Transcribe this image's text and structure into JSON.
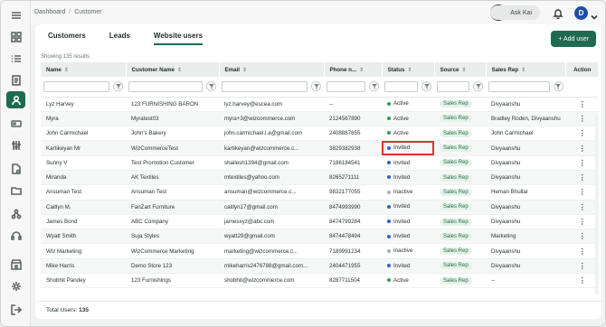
{
  "breadcrumb": {
    "root": "Dashboard",
    "separator": "/",
    "current": "Customer"
  },
  "user": {
    "ask_label": "Ask Kai",
    "initial": "D"
  },
  "tabs": [
    {
      "label": "Customers",
      "active": false
    },
    {
      "label": "Leads",
      "active": false
    },
    {
      "label": "Website users",
      "active": true
    }
  ],
  "add_user_label": "+ Add user",
  "showing_text": "Showing 135 results",
  "columns": [
    "Name",
    "Customer Name",
    "Email",
    "Phone n...",
    "Status",
    "Source",
    "Sales Rep",
    "Action"
  ],
  "rows": [
    {
      "name": "Lyz Harvey",
      "customer": "123 FURNISHING BARON",
      "email": "lyz.harvey@escea.com",
      "phone": "--",
      "status": "Active",
      "source": "Sales Rep",
      "rep": "Divyaanshu"
    },
    {
      "name": "Myra",
      "customer": "Myratest03",
      "email": "myra+3@wizcommerce.com",
      "phone": "2124567890",
      "status": "Active",
      "source": "Sales Rep",
      "rep": "Bradley Roden, Divyaanshu"
    },
    {
      "name": "John Carmichael",
      "customer": "John's Bakery",
      "email": "john.carmichael.l.a@gmail.com",
      "phone": "2408887655",
      "status": "Active",
      "source": "Sales Rep",
      "rep": "John Carmichael"
    },
    {
      "name": "Kartikeyan Mr",
      "customer": "WizCommerceTest",
      "email": "kartikeyan@wizcommerce.c...",
      "phone": "3829382938",
      "status": "Invited",
      "source": "Sales Rep",
      "rep": "Divyaanshu"
    },
    {
      "name": "Sunny V",
      "customer": "Test Promotion Customer",
      "email": "shailesh1394@gmail.com",
      "phone": "7186184541",
      "status": "Invited",
      "source": "Sales Rep",
      "rep": "Divyaanshu"
    },
    {
      "name": "Miranda",
      "customer": "AK Textiles",
      "email": "mtextiles@yahoo.com",
      "phone": "8265271111",
      "status": "Invited",
      "source": "Sales Rep",
      "rep": "Divyaanshu"
    },
    {
      "name": "Ansuman Test",
      "customer": "Ansuman Test",
      "email": "ansuman@wizcommerce.c...",
      "phone": "9832177055",
      "status": "Inactive",
      "source": "Sales Rep",
      "rep": "Heman Bhullar"
    },
    {
      "name": "Caitlyn M.",
      "customer": "FanZart Furniture",
      "email": "caitlyn17@gmail.com",
      "phone": "8474993990",
      "status": "Invited",
      "source": "Sales Rep",
      "rep": "Divyaanshu"
    },
    {
      "name": "James Bond",
      "customer": "ABC Company",
      "email": "jamesxyz@abc.com",
      "phone": "8474799284",
      "status": "Invited",
      "source": "Sales Rep",
      "rep": "Divyaanshu"
    },
    {
      "name": "Wyatt Smith",
      "customer": "Suja Styles",
      "email": "wyatt29@gmail.com",
      "phone": "8474478494",
      "status": "Invited",
      "source": "Sales Rep",
      "rep": "Marketing"
    },
    {
      "name": "Wiz Marketing",
      "customer": "WizCommerce Marketing",
      "email": "marketing@wizcommerce.c...",
      "phone": "7189991234",
      "status": "Inactive",
      "source": "Sales Rep",
      "rep": "Divyaanshu"
    },
    {
      "name": "Mike Harris",
      "customer": "Demo Store 123",
      "email": "mikeharris2476788@gmail.com...",
      "phone": "2404471955",
      "status": "Invited",
      "source": "Sales Rep",
      "rep": "Divyaanshu"
    },
    {
      "name": "Shobhit Pandey",
      "customer": "123 Furnishings",
      "email": "shobhit@wizcommerce.com",
      "phone": "8287711504",
      "status": "Active",
      "source": "Sales Rep",
      "rep": "--"
    }
  ],
  "status_colors": {
    "Active": "#2e9e4f",
    "Invited": "#2f5fd0",
    "Inactive": "#a8b0af"
  },
  "highlight_row": 3,
  "footer": {
    "label": "Total Users:",
    "count": "135"
  },
  "icons": [
    "menu-icon",
    "grid-icon",
    "list-icon",
    "document-icon",
    "user-icon",
    "tag-icon",
    "sliders-icon",
    "file-icon",
    "folder-icon",
    "network-icon",
    "headset-icon",
    "store-icon",
    "settings-icon",
    "logout-icon"
  ]
}
